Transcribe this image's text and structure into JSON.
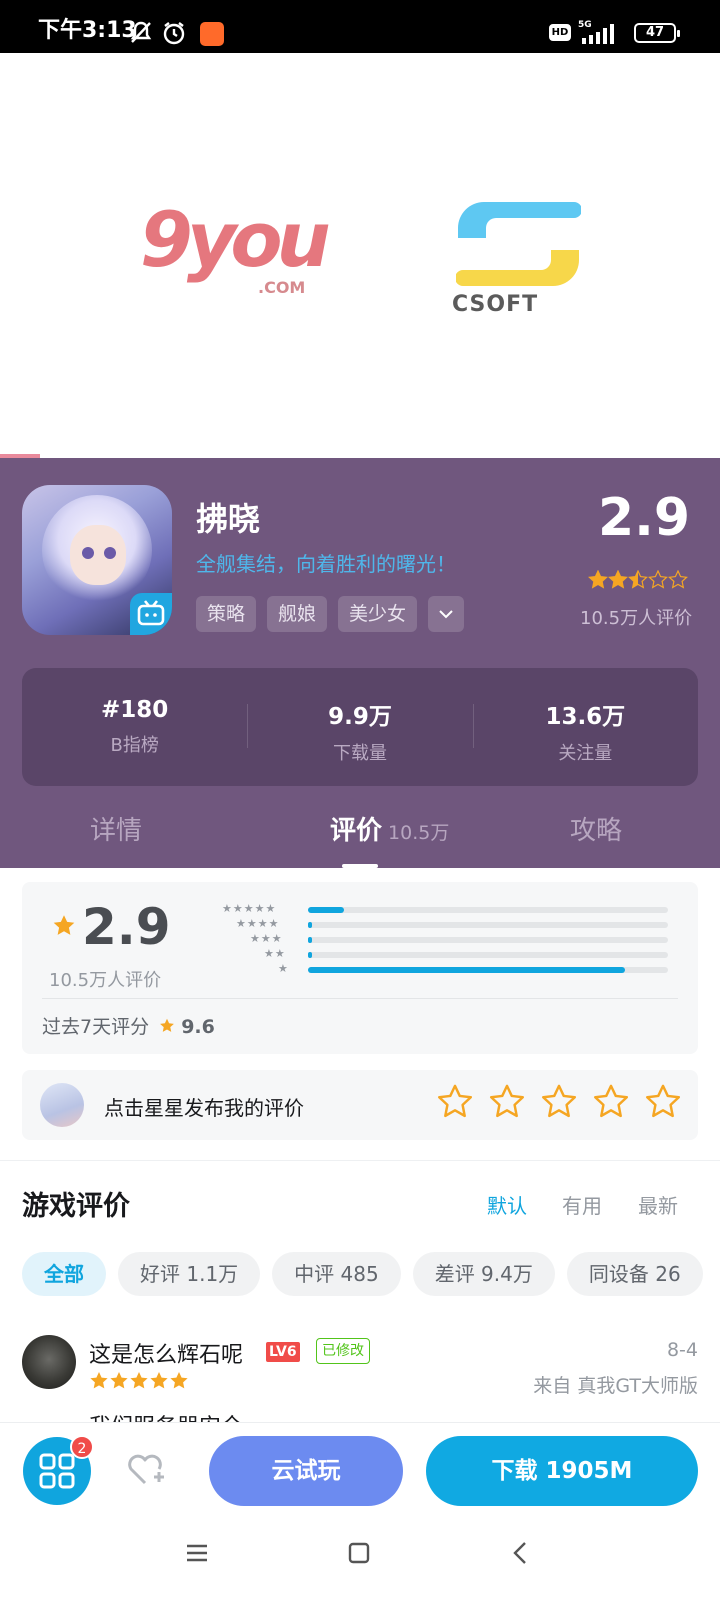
{
  "status_bar": {
    "time": "下午3:13",
    "network": "5G",
    "battery": "47"
  },
  "banner": {
    "partner_logo_1": "9you.com",
    "partner_logo_1_mark": "9you",
    "partner_logo_1_suffix": ".COM",
    "partner_logo_2": "CSOFT"
  },
  "app": {
    "name": "拂晓",
    "slogan": "全舰集结，向着胜利的曙光！",
    "tags": [
      "策略",
      "舰娘",
      "美少女"
    ],
    "rating": "2.9",
    "rating_stars": 2.5,
    "rating_count": "10.5万人评价"
  },
  "stats": [
    {
      "value": "#180",
      "label": "B指榜"
    },
    {
      "value": "9.9万",
      "label": "下载量"
    },
    {
      "value": "13.6万",
      "label": "关注量"
    }
  ],
  "tabs": {
    "details": "详情",
    "reviews": "评价",
    "reviews_count": "10.5万",
    "guides": "攻略"
  },
  "rating_card": {
    "score": "2.9",
    "count": "10.5万人评价",
    "distribution": [
      {
        "stars": 5,
        "fraction": 0.1
      },
      {
        "stars": 4,
        "fraction": 0.005
      },
      {
        "stars": 3,
        "fraction": 0.005
      },
      {
        "stars": 2,
        "fraction": 0.005
      },
      {
        "stars": 1,
        "fraction": 0.88
      }
    ],
    "recent_label": "过去7天评分",
    "recent_score": "9.6"
  },
  "post_rating": {
    "prompt": "点击星星发布我的评价"
  },
  "reviews_section": {
    "title": "游戏评价",
    "sort_options": [
      "默认",
      "有用",
      "最新"
    ],
    "active_sort": "默认",
    "filters": [
      "全部",
      "好评 1.1万",
      "中评 485",
      "差评 9.4万",
      "同设备 26"
    ],
    "active_filter": "全部"
  },
  "review": {
    "name": "这是怎么辉石呢",
    "level": "LV6",
    "modified": "已修改",
    "stars": 5,
    "date": "8-4",
    "device": "来自 真我GT大师版",
    "body_preview": "我们服务器安全…"
  },
  "bottom_bar": {
    "badge_count": "2",
    "cloud_play": "云试玩",
    "download": "下载 1905M"
  },
  "colors": {
    "header_bg": "#70577e",
    "accent": "#10a5de",
    "star": "#f5a623"
  }
}
